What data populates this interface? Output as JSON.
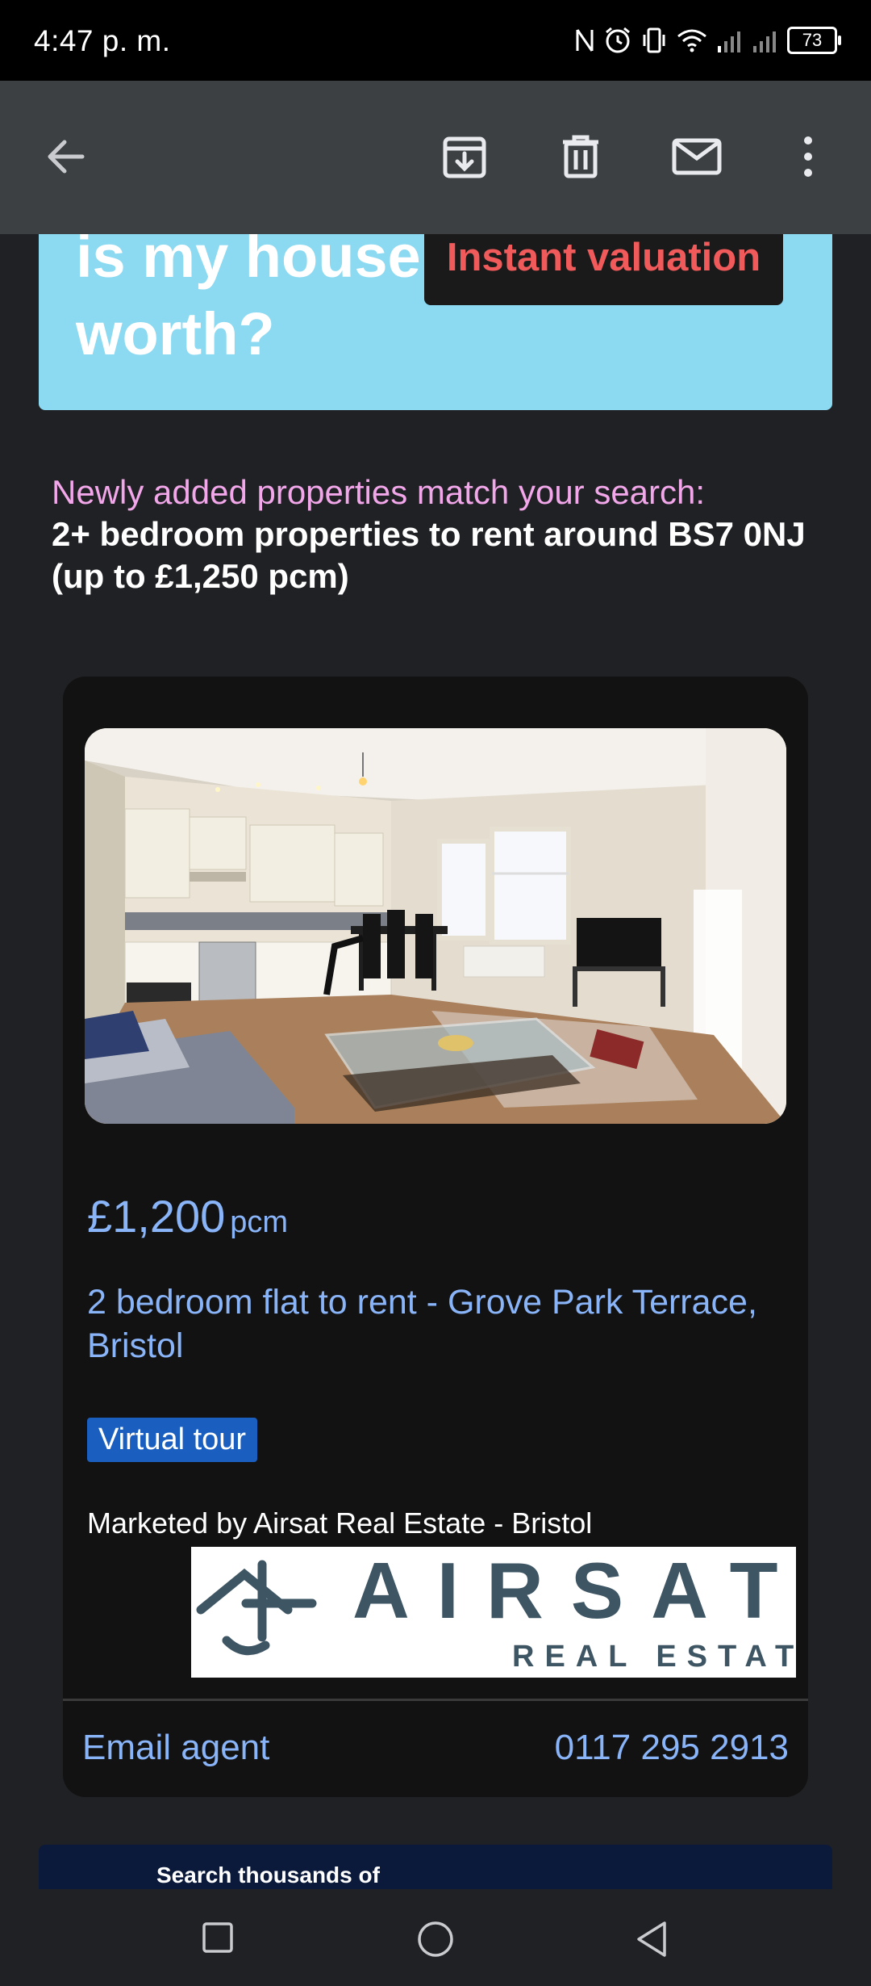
{
  "status_bar": {
    "time": "4:47 p. m.",
    "battery": "73",
    "icons": [
      "nfc-icon",
      "alarm-icon",
      "vibrate-icon",
      "wifi-icon",
      "signal-icon",
      "signal-icon",
      "battery-icon"
    ]
  },
  "app_bar": {
    "icons": [
      "back-arrow-icon",
      "archive-icon",
      "delete-icon",
      "mark-unread-icon",
      "more-vert-icon"
    ]
  },
  "hero": {
    "title": "is my house worth?",
    "button_label": "Instant valuation",
    "background_color": "#8bdaf2"
  },
  "intro": {
    "lead": "Newly added properties match your search:",
    "criteria": "2+ bedroom properties to rent around BS7 0NJ (up to £1,250 pcm)"
  },
  "listing": {
    "price": "£1,200",
    "price_unit": "pcm",
    "title": "2 bedroom flat to rent - Grove Park Terrace, Bristol",
    "badge": "Virtual tour",
    "marketed_by": "Marketed by Airsat Real Estate - Bristol",
    "logo_text": "AIRSAT",
    "logo_subtext": "REAL ESTATE",
    "email_agent": "Email agent",
    "phone": "0117 295 2913"
  },
  "promo": {
    "text": "Search thousands of"
  },
  "nav_bar": {
    "icons": [
      "recents-icon",
      "home-icon",
      "back-icon"
    ]
  },
  "colors": {
    "link": "#8ab4f8",
    "accent_red": "#f05a5a",
    "lead_pink": "#f2a7ea",
    "badge_blue": "#1a5fbf"
  }
}
